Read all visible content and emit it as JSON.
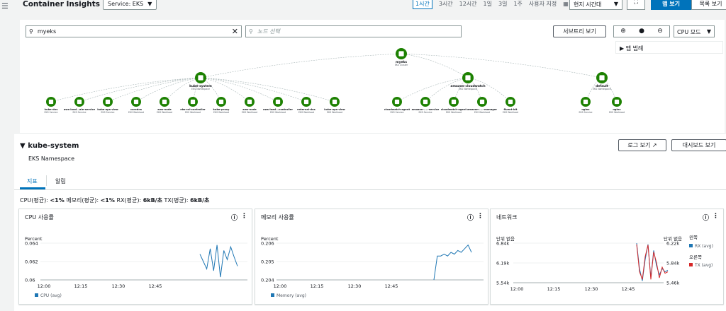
{
  "header": {
    "menu_icon": "hamburger-icon",
    "title": "Container Insights",
    "service_select": "Service: EKS",
    "time_ranges": [
      "1시간",
      "3시간",
      "12시간",
      "1일",
      "3일",
      "1주",
      "사용자 지정"
    ],
    "selected_time_range": "1시간",
    "timezone": "현지 시간대",
    "map_view": "맵 보기",
    "list_view": "목록 보기"
  },
  "map": {
    "search_value": "myeks",
    "node_placeholder": "노드 선택",
    "subtree_button": "서브트리 보기",
    "zoom_center": "●",
    "cpu_mode": "CPU 모드",
    "legend": "맵 범례",
    "root": {
      "name": "myeks",
      "type": "EKS Cluster"
    },
    "namespaces": [
      {
        "name": "kube-system",
        "type": "EKS Namespace",
        "children": [
          {
            "name": "kube-dns",
            "type": "EKS Service"
          },
          {
            "name": "aws-load...ale-service",
            "type": "EKS Service"
          },
          {
            "name": "kube-ops-view",
            "type": "EKS Service"
          },
          {
            "name": "coredns",
            "type": "EKS Workload"
          },
          {
            "name": "aws-node",
            "type": "EKS Workload"
          },
          {
            "name": "ebs-csi-controller",
            "type": "EKS Workload"
          },
          {
            "name": "kube-proxy",
            "type": "EKS Workload"
          },
          {
            "name": "aws-node",
            "type": "EKS Workload"
          },
          {
            "name": "aws-load...controller",
            "type": "EKS Workload"
          },
          {
            "name": "external-dns",
            "type": "EKS Workload"
          },
          {
            "name": "kube-ops-view",
            "type": "EKS Workload"
          }
        ]
      },
      {
        "name": "amazon-cloudwatch",
        "type": "EKS Namespace",
        "children": [
          {
            "name": "cloudwatch-agent",
            "type": "EKS Service"
          },
          {
            "name": "amazon-....-service",
            "type": "EKS Service"
          },
          {
            "name": "cloudwatch-agent",
            "type": "EKS Workload"
          },
          {
            "name": "amazon-....-manager",
            "type": "EKS Workload"
          },
          {
            "name": "fluent-bit",
            "type": "EKS Workload"
          }
        ]
      },
      {
        "name": "default",
        "type": "EKS Namespace",
        "children": [
          {
            "name": "nginx",
            "type": "EKS Service"
          },
          {
            "name": "nginx",
            "type": "EKS Workload"
          }
        ]
      }
    ]
  },
  "detail": {
    "namespace": "kube-system",
    "namespace_type": "EKS Namespace",
    "logs_button": "로그 보기",
    "dashboard_button": "대시보드 보기",
    "tabs": [
      "지표",
      "알림"
    ],
    "summary": [
      {
        "label": "CPU(평균):",
        "value": "<1%"
      },
      {
        "label": "메모리(평균):",
        "value": "<1%"
      },
      {
        "label": "RX(평균):",
        "value": "6kB/초"
      },
      {
        "label": "TX(평균):",
        "value": "6kB/초"
      }
    ]
  },
  "colors": {
    "accent": "#0073bb",
    "node": "#1d8102",
    "rx": "#1f77b4",
    "tx": "#d62728"
  },
  "chart_data": [
    {
      "type": "line",
      "title": "CPU 사용률",
      "ylabel": "Percent",
      "ylim": [
        0.06,
        0.064
      ],
      "yticks": [
        "0.064",
        "0.062",
        "0.06"
      ],
      "xticks": [
        "12:00",
        "12:15",
        "12:30",
        "12:45"
      ],
      "series": [
        {
          "name": "CPU (avg)",
          "values": [
            0.0628,
            0.062,
            0.0612,
            0.0634,
            0.061,
            0.0638,
            0.0603,
            0.0632,
            0.0622,
            0.0636,
            0.0625,
            0.0615
          ]
        }
      ]
    },
    {
      "type": "line",
      "title": "메모리 사용률",
      "ylabel": "Percent",
      "ylim": [
        0.204,
        0.206
      ],
      "yticks": [
        "0.206",
        "0.205",
        "0.204"
      ],
      "xticks": [
        "12:00",
        "12:15",
        "12:30",
        "12:45"
      ],
      "series": [
        {
          "name": "Memory (avg)",
          "values": [
            0.204,
            0.2053,
            0.2053,
            0.2054,
            0.2053,
            0.2055,
            0.2054,
            0.2056,
            0.2055,
            0.2057,
            0.2059,
            0.2055
          ]
        }
      ]
    },
    {
      "type": "line",
      "title": "네트워크",
      "ylabel": "단위 없음",
      "ylabel_right": "단위 없음",
      "ylim": [
        5540,
        6840
      ],
      "yticks": [
        "6.84k",
        "6.19k",
        "5.54k"
      ],
      "yticks_right": [
        "6.22k",
        "5.84k",
        "5.46k"
      ],
      "legend_left_title": "왼쪽",
      "legend_right_title": "오른쪽",
      "xticks": [
        "12:00",
        "12:15",
        "12:30",
        "12:45"
      ],
      "series": [
        {
          "name": "RX (avg)",
          "values": [
            6840,
            6000,
            5600,
            6300,
            6800,
            5700,
            6600,
            6100,
            5800,
            6000,
            5900,
            5950
          ]
        },
        {
          "name": "TX (avg)",
          "values": [
            6800,
            5900,
            5650,
            6400,
            6780,
            5650,
            6550,
            6200,
            5700,
            6050,
            5850,
            5900
          ]
        }
      ]
    }
  ]
}
